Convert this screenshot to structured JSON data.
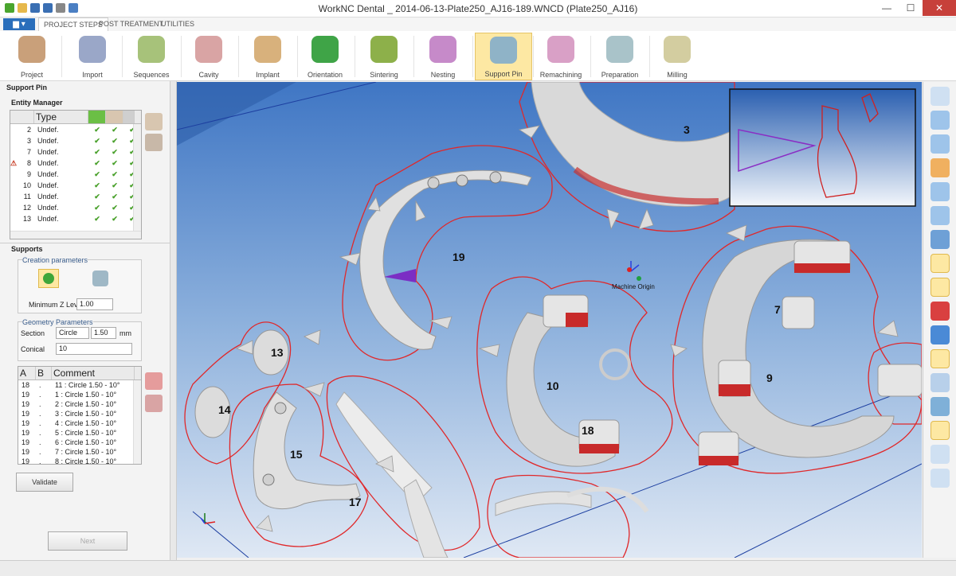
{
  "window": {
    "title": "WorkNC Dental _ 2014-06-13-Plate250_AJ16-189.WNCD (Plate250_AJ16)",
    "minimize": "—",
    "maximize": "☐",
    "close": "✕"
  },
  "menu": {
    "file": "▆ ▾",
    "tabs": [
      "PROJECT STEPS",
      "POST TREATMENT",
      "UTILITIES"
    ]
  },
  "ribbon": [
    {
      "label": "Project",
      "icon": "project-icon",
      "color": "#c9a07a"
    },
    {
      "label": "Import",
      "icon": "import-icon",
      "color": "#9aa7c8"
    },
    {
      "label": "Sequences",
      "icon": "sequences-icon",
      "color": "#a7c27a"
    },
    {
      "label": "Cavity",
      "icon": "cavity-icon",
      "color": "#d9a4a4"
    },
    {
      "label": "Implant",
      "icon": "implant-icon",
      "color": "#d8b17c"
    },
    {
      "label": "Orientation",
      "icon": "orientation-icon",
      "color": "#3fa447"
    },
    {
      "label": "Sintering",
      "icon": "sintering-icon",
      "color": "#8db04a"
    },
    {
      "label": "Nesting",
      "icon": "nesting-icon",
      "color": "#c68ac9"
    },
    {
      "label": "Support Pin",
      "icon": "support-pin-icon",
      "color": "#8fb3c7"
    },
    {
      "label": "Remachining",
      "icon": "remachining-icon",
      "color": "#d9a0c6"
    },
    {
      "label": "Preparation",
      "icon": "preparation-icon",
      "color": "#a9c3c9"
    },
    {
      "label": "Milling",
      "icon": "milling-icon",
      "color": "#d3cda0"
    }
  ],
  "panel": {
    "title": "Support Pin",
    "entity_manager": {
      "label": "Entity Manager",
      "header": "Type",
      "rows": [
        {
          "id": "2",
          "type": "Undef.",
          "warn": false
        },
        {
          "id": "3",
          "type": "Undef.",
          "warn": false
        },
        {
          "id": "7",
          "type": "Undef.",
          "warn": false
        },
        {
          "id": "8",
          "type": "Undef.",
          "warn": true
        },
        {
          "id": "9",
          "type": "Undef.",
          "warn": false
        },
        {
          "id": "10",
          "type": "Undef.",
          "warn": false
        },
        {
          "id": "11",
          "type": "Undef.",
          "warn": false
        },
        {
          "id": "12",
          "type": "Undef.",
          "warn": false
        },
        {
          "id": "13",
          "type": "Undef.",
          "warn": false
        }
      ]
    },
    "supports": {
      "label": "Supports",
      "creation_label": "Creation parameters",
      "min_z_label": "Minimum Z Level",
      "min_z_value": "1.00",
      "geometry_label": "Geometry Parameters",
      "section_label": "Section",
      "section_value": "Circle",
      "section_size": "1.50",
      "section_unit": "mm",
      "conical_label": "Conical",
      "conical_value": "10"
    },
    "comments": {
      "headers": [
        "A",
        "B",
        "Comment"
      ],
      "rows": [
        {
          "a": "18",
          "b": ".",
          "c": "11 : Circle 1.50 - 10°"
        },
        {
          "a": "19",
          "b": ".",
          "c": "1 : Circle 1.50 - 10°"
        },
        {
          "a": "19",
          "b": ".",
          "c": "2 : Circle 1.50 - 10°"
        },
        {
          "a": "19",
          "b": ".",
          "c": "3 : Circle 1.50 - 10°"
        },
        {
          "a": "19",
          "b": ".",
          "c": "4 : Circle 1.50 - 10°"
        },
        {
          "a": "19",
          "b": ".",
          "c": "5 : Circle 1.50 - 10°"
        },
        {
          "a": "19",
          "b": ".",
          "c": "6 : Circle 1.50 - 10°"
        },
        {
          "a": "19",
          "b": ".",
          "c": "7 : Circle 1.50 - 10°"
        },
        {
          "a": "19",
          "b": ".",
          "c": "8 : Circle 1.50 - 10°"
        }
      ]
    },
    "validate": "Validate",
    "next": "Next"
  },
  "viewport": {
    "origin_label": "Machine Origin",
    "part_labels": [
      "3",
      "19",
      "7",
      "9",
      "13",
      "10",
      "18",
      "14",
      "15",
      "17"
    ]
  },
  "colors": {
    "accent": "#2a6ebb",
    "contour": "#e0282a",
    "active": "#fde8a3"
  }
}
